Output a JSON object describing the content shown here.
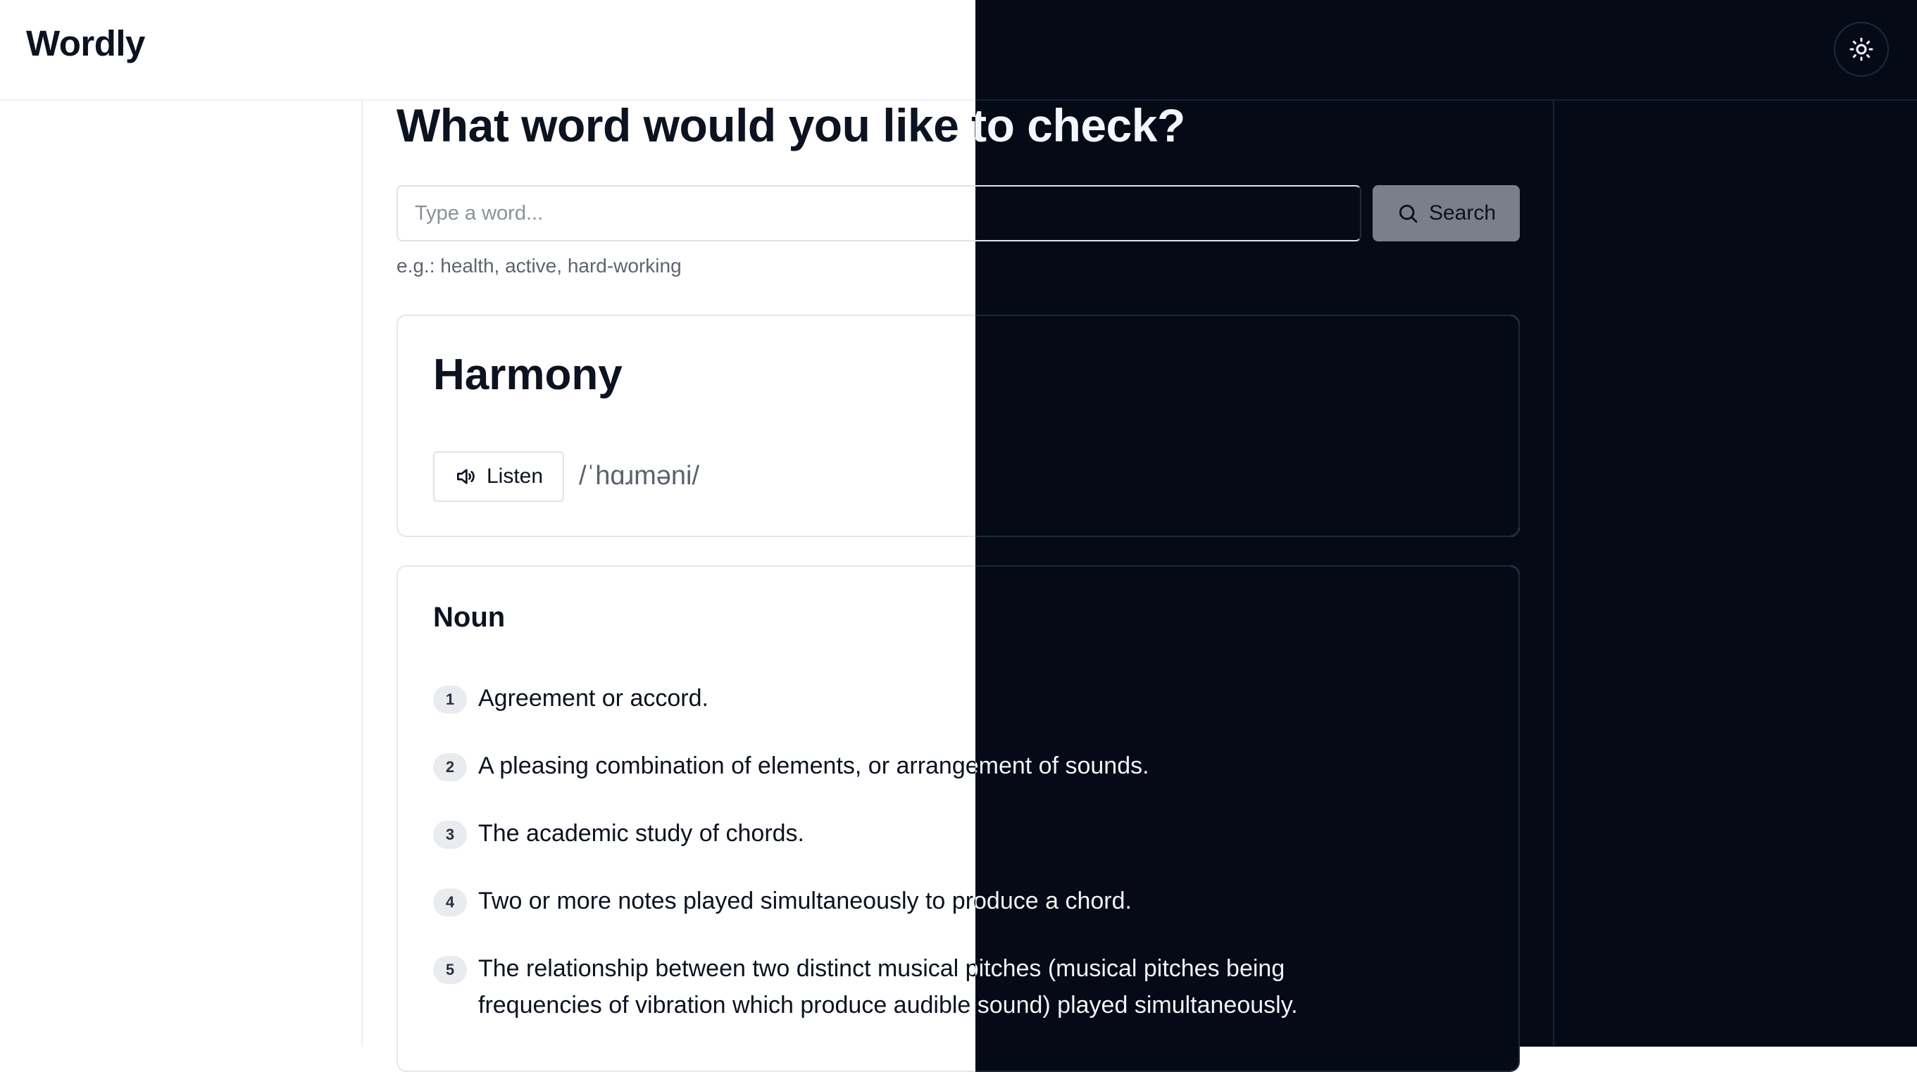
{
  "app": {
    "title": "Wordly"
  },
  "header": {
    "theme_toggle_icon": "sun-icon"
  },
  "search": {
    "heading": "What word would you like to check?",
    "placeholder": "Type a word...",
    "value": "",
    "button_label": "Search",
    "button_icon": "search-icon",
    "hint": "e.g.: health, active, hard-working"
  },
  "word": {
    "title": "Harmony",
    "listen_label": "Listen",
    "listen_icon": "speaker-icon",
    "phonetic": "/ˈhɑɹməni/"
  },
  "meanings": [
    {
      "part_of_speech": "Noun",
      "definitions": [
        {
          "number": "1",
          "text": "Agreement or accord."
        },
        {
          "number": "2",
          "text": "A pleasing combination of elements, or arrangement of sounds."
        },
        {
          "number": "3",
          "text": "The academic study of chords."
        },
        {
          "number": "4",
          "text": "Two or more notes played simultaneously to produce a chord."
        },
        {
          "number": "5",
          "text": "The relationship between two distinct musical pitches (musical pitches being frequencies of vibration which produce audible sound) played simultaneously."
        }
      ]
    }
  ],
  "colors": {
    "light_background": "#ffffff",
    "dark_background": "#050b16",
    "text_primary": "#0b1220",
    "search_button": "#7a7f89"
  }
}
